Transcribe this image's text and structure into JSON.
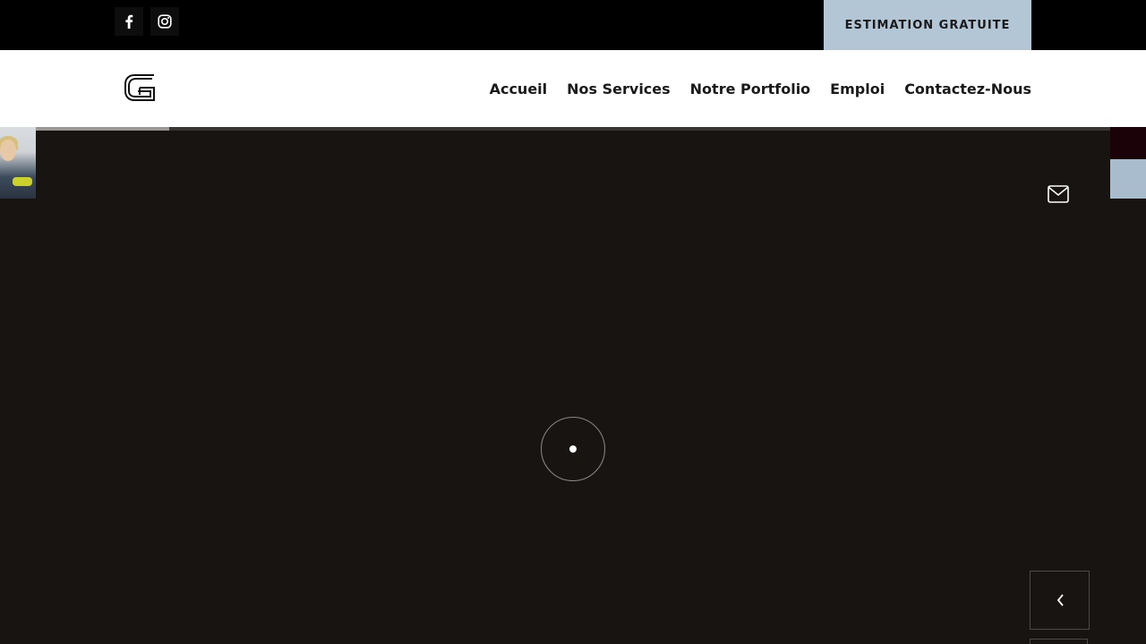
{
  "topbar": {
    "social": [
      {
        "name": "facebook-icon"
      },
      {
        "name": "instagram-icon"
      }
    ],
    "cta_label": "ESTIMATION GRATUITE",
    "cta_color": "#b3c6d6"
  },
  "header": {
    "logo_icon": "g-logo-icon",
    "nav": [
      {
        "label": "Accueil"
      },
      {
        "label": "Nos Services"
      },
      {
        "label": "Notre Portfolio"
      },
      {
        "label": "Emploi"
      },
      {
        "label": "Contactez-Nous"
      }
    ]
  },
  "hero": {
    "background": "#181411",
    "slide_progress": 0.148,
    "loader": "loading-spinner",
    "icons": [
      "mail-icon",
      "chevron-left-icon"
    ]
  }
}
